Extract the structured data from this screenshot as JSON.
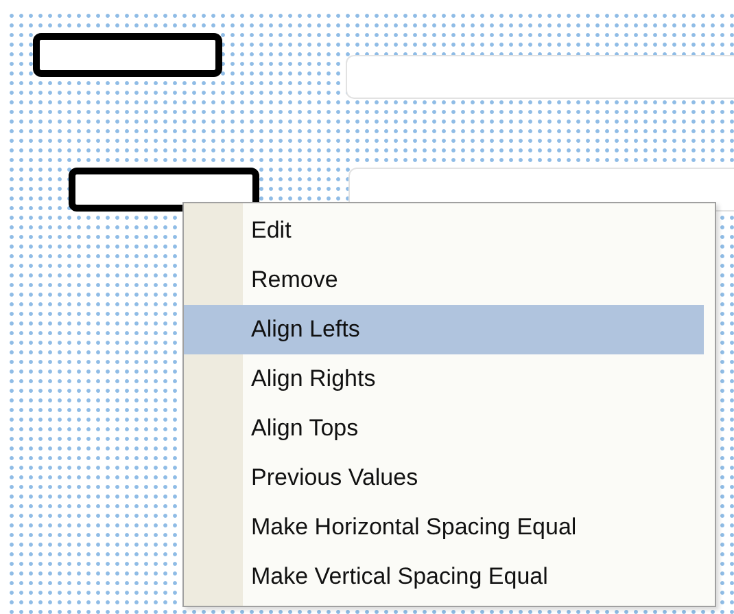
{
  "canvas_controls": [
    {
      "kind": "label",
      "selected": true
    },
    {
      "kind": "textbox",
      "selected": false
    },
    {
      "kind": "label",
      "selected": true
    },
    {
      "kind": "textbox",
      "selected": false
    }
  ],
  "context_menu": {
    "items": [
      {
        "label": "Edit",
        "selected": false
      },
      {
        "label": "Remove",
        "selected": false
      },
      {
        "label": "Align Lefts",
        "selected": true
      },
      {
        "label": "Align Rights",
        "selected": false
      },
      {
        "label": "Align Tops",
        "selected": false
      },
      {
        "label": "Previous Values",
        "selected": false
      },
      {
        "label": "Make Horizontal Spacing Equal",
        "selected": false
      },
      {
        "label": "Make Vertical Spacing Equal",
        "selected": false
      }
    ]
  }
}
